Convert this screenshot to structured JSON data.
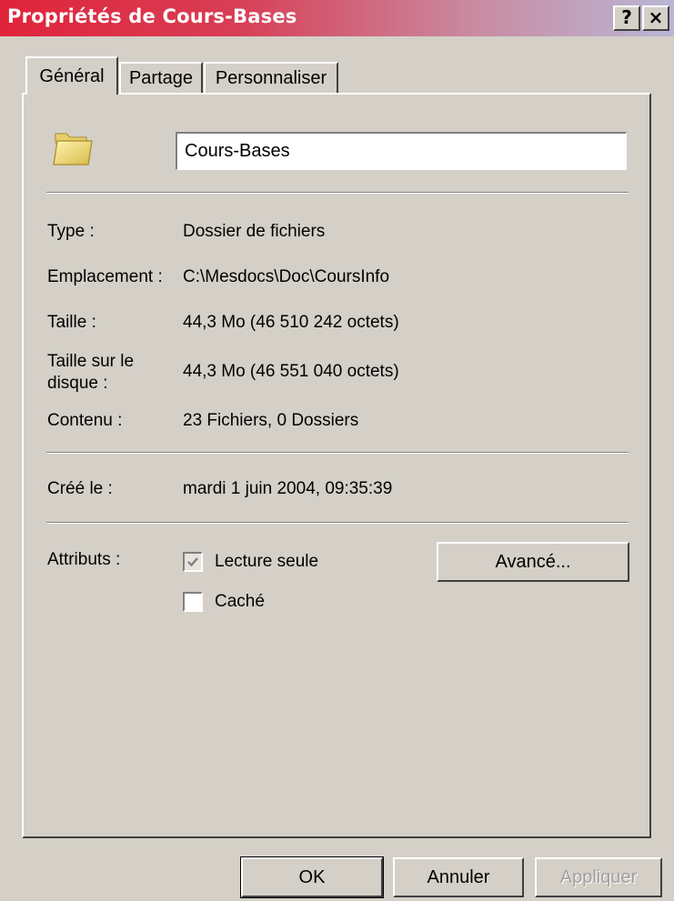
{
  "window": {
    "title": "Propriétés de Cours-Bases",
    "help_glyph": "?",
    "close_glyph": "×"
  },
  "tabs": [
    {
      "label": "Général",
      "active": true
    },
    {
      "label": "Partage",
      "active": false
    },
    {
      "label": "Personnaliser",
      "active": false
    }
  ],
  "general": {
    "folder_icon": "folder-icon",
    "name_value": "Cours-Bases",
    "fields": [
      {
        "label": "Type :",
        "value": "Dossier de fichiers"
      },
      {
        "label": "Emplacement :",
        "value": "C:\\Mesdocs\\Doc\\CoursInfo"
      },
      {
        "label": "Taille :",
        "value": "44,3 Mo (46 510 242 octets)"
      },
      {
        "label_line1": "Taille sur le",
        "label_line2": "disque :",
        "value": "44,3 Mo (46 551 040 octets)"
      },
      {
        "label": "Contenu :",
        "value": "23 Fichiers, 0 Dossiers"
      }
    ],
    "created": {
      "label": "Créé le :",
      "value": "mardi 1 juin 2004, 09:35:39"
    },
    "attributes": {
      "label": "Attributs :",
      "readonly": {
        "label": "Lecture seule",
        "checked": true,
        "disabled": true
      },
      "hidden": {
        "label": "Caché",
        "checked": false
      },
      "advanced_label": "Avancé..."
    }
  },
  "footer": {
    "ok_label": "OK",
    "cancel_label": "Annuler",
    "apply_label": "Appliquer"
  },
  "colors": {
    "face": "#d4d0c8",
    "title_start": "#e0243a",
    "title_end": "#b9b7d6"
  }
}
